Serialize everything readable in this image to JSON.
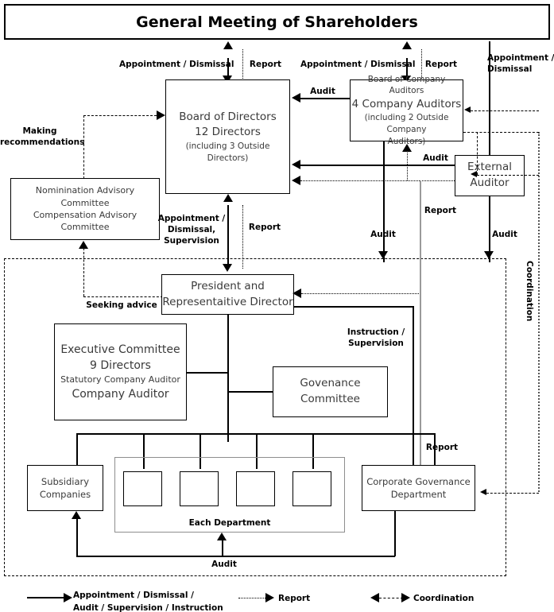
{
  "title": "General Meeting of Shareholders",
  "boxes": {
    "board_of_directors": {
      "line1": "Board of Directors",
      "line2": "12  Directors",
      "line3": "(including 3 Outside",
      "line4": "Directors)"
    },
    "board_of_company_auditors": {
      "line1": "Board of Company Auditors",
      "line2": "4 Company Auditors",
      "line3": "(including 2 Outside Company",
      "line4": "Auditors)"
    },
    "external_auditor": {
      "line1": "External",
      "line2": "Auditor"
    },
    "advisory_committees": {
      "line1": "Nominination Advisory Committee",
      "line2": "Compensation Advisory Committee"
    },
    "president": {
      "line1": "President and",
      "line2": "Representaitive Director"
    },
    "executive_committee": {
      "line1": "Executive Committee",
      "line2": "9 Directors",
      "line3": "Statutory Company Auditor",
      "line4": "Company Auditor"
    },
    "governance_committee": {
      "line1": "Govenance",
      "line2": "Committee"
    },
    "subsidiary_companies": {
      "line1": "Subsidiary",
      "line2": "Companies"
    },
    "corporate_governance_department": {
      "line1": "Corporate Governance",
      "line2": "Department"
    },
    "each_department": {
      "label": "Each Department"
    }
  },
  "labels": {
    "appointment_dismissal_1": "Appointment / Dismissal",
    "report_1": "Report",
    "appointment_dismissal_2": "Appointment / Dismissal",
    "report_2": "Report",
    "appointment_dismissal_3": "Appointment /\nDismissal",
    "making_recommendations": "Making\nrecommendations",
    "audit_bod": "Audit",
    "audit_ea_to_bca": "Audit",
    "report_ea": "Report",
    "audit_left_down": "Audit",
    "audit_right_down": "Audit",
    "appointment_dismissal_supervision": "Appointment /\nDismissal,\nSupervision",
    "report_president": "Report",
    "seeking_advice": "Seeking advice",
    "instruction_supervision": "Instruction /\nSupervision",
    "report_cgd": "Report",
    "audit_bottom": "Audit",
    "coordination_vertical": "Coordination"
  },
  "legend": {
    "solid": "Appointment / Dismissal /\nAudit / Supervision / Instruction",
    "dotted": "Report",
    "dashdot": "Coordination"
  },
  "colors": {
    "line": "#000000",
    "gray_line": "#8e8e8e",
    "text": "#3a3a3a",
    "background": "#ffffff"
  }
}
